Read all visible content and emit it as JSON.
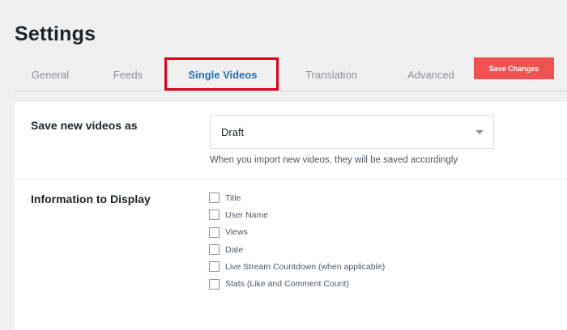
{
  "page": {
    "title": "Settings"
  },
  "tabs": [
    {
      "label": "General",
      "active": false
    },
    {
      "label": "Feeds",
      "active": false
    },
    {
      "label": "Single Videos",
      "active": true
    },
    {
      "label": "Translation",
      "active": false
    },
    {
      "label": "Advanced",
      "active": false
    }
  ],
  "toolbar": {
    "save_label": "Save Changes"
  },
  "save_videos": {
    "label": "Save new videos as",
    "selected": "Draft",
    "help": "When you import new videos, they will be saved accordingly"
  },
  "info_display": {
    "label": "Information to Display",
    "options": [
      {
        "label": "Title",
        "checked": false
      },
      {
        "label": "User Name",
        "checked": false
      },
      {
        "label": "Views",
        "checked": false
      },
      {
        "label": "Date",
        "checked": false
      },
      {
        "label": "Live Stream Countdown (when applicable)",
        "checked": false
      },
      {
        "label": "Stats (Like and Comment Count)",
        "checked": false
      }
    ]
  },
  "colors": {
    "accent": "#2271b1",
    "save_button": "#f05252",
    "highlight": "#e0001b",
    "background": "#f0f0f1"
  }
}
